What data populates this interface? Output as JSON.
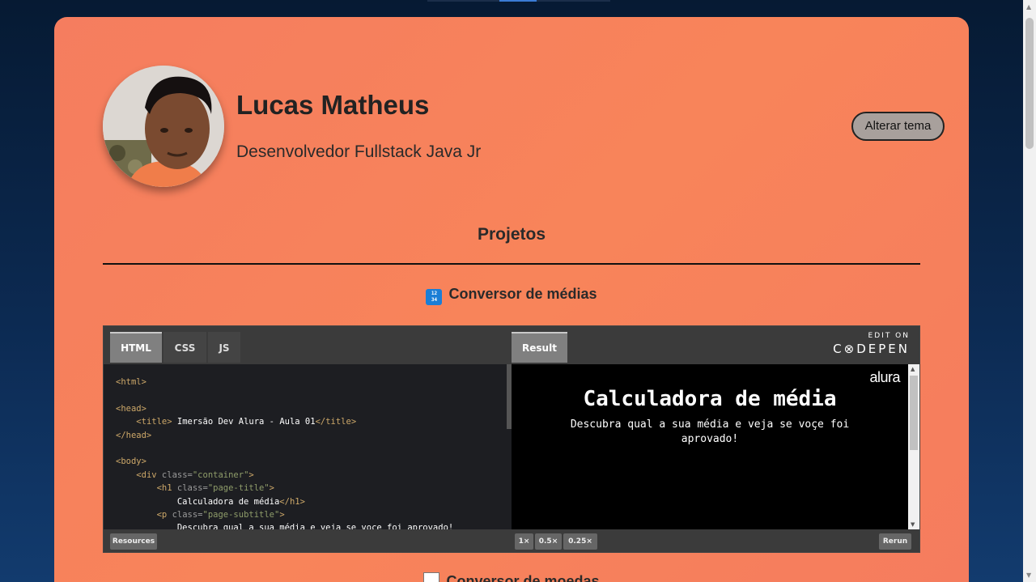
{
  "profile": {
    "name": "Lucas Matheus",
    "role": "Desenvolvedor Fullstack Java Jr"
  },
  "theme_button": "Alterar tema",
  "section_title": "Projetos",
  "projects": [
    {
      "title": "Conversor de médias",
      "icon": "numbers-icon"
    },
    {
      "title": "Conversor de moedas",
      "icon": "chart-icon"
    }
  ],
  "pen": {
    "tabs": [
      "HTML",
      "CSS",
      "JS"
    ],
    "result_tab": "Result",
    "edit_on": "EDIT ON",
    "codepen": "C⊗DEPEN",
    "resources": "Resources",
    "zoom": [
      "1×",
      "0.5×",
      "0.25×"
    ],
    "rerun": "Rerun",
    "result": {
      "logo": "alura",
      "title": "Calculadora de média",
      "subtitle": "Descubra qual a sua média e veja se voçe foi aprovado!"
    }
  },
  "colors": {
    "card": "#f8845a",
    "background": "#0c2a52"
  }
}
